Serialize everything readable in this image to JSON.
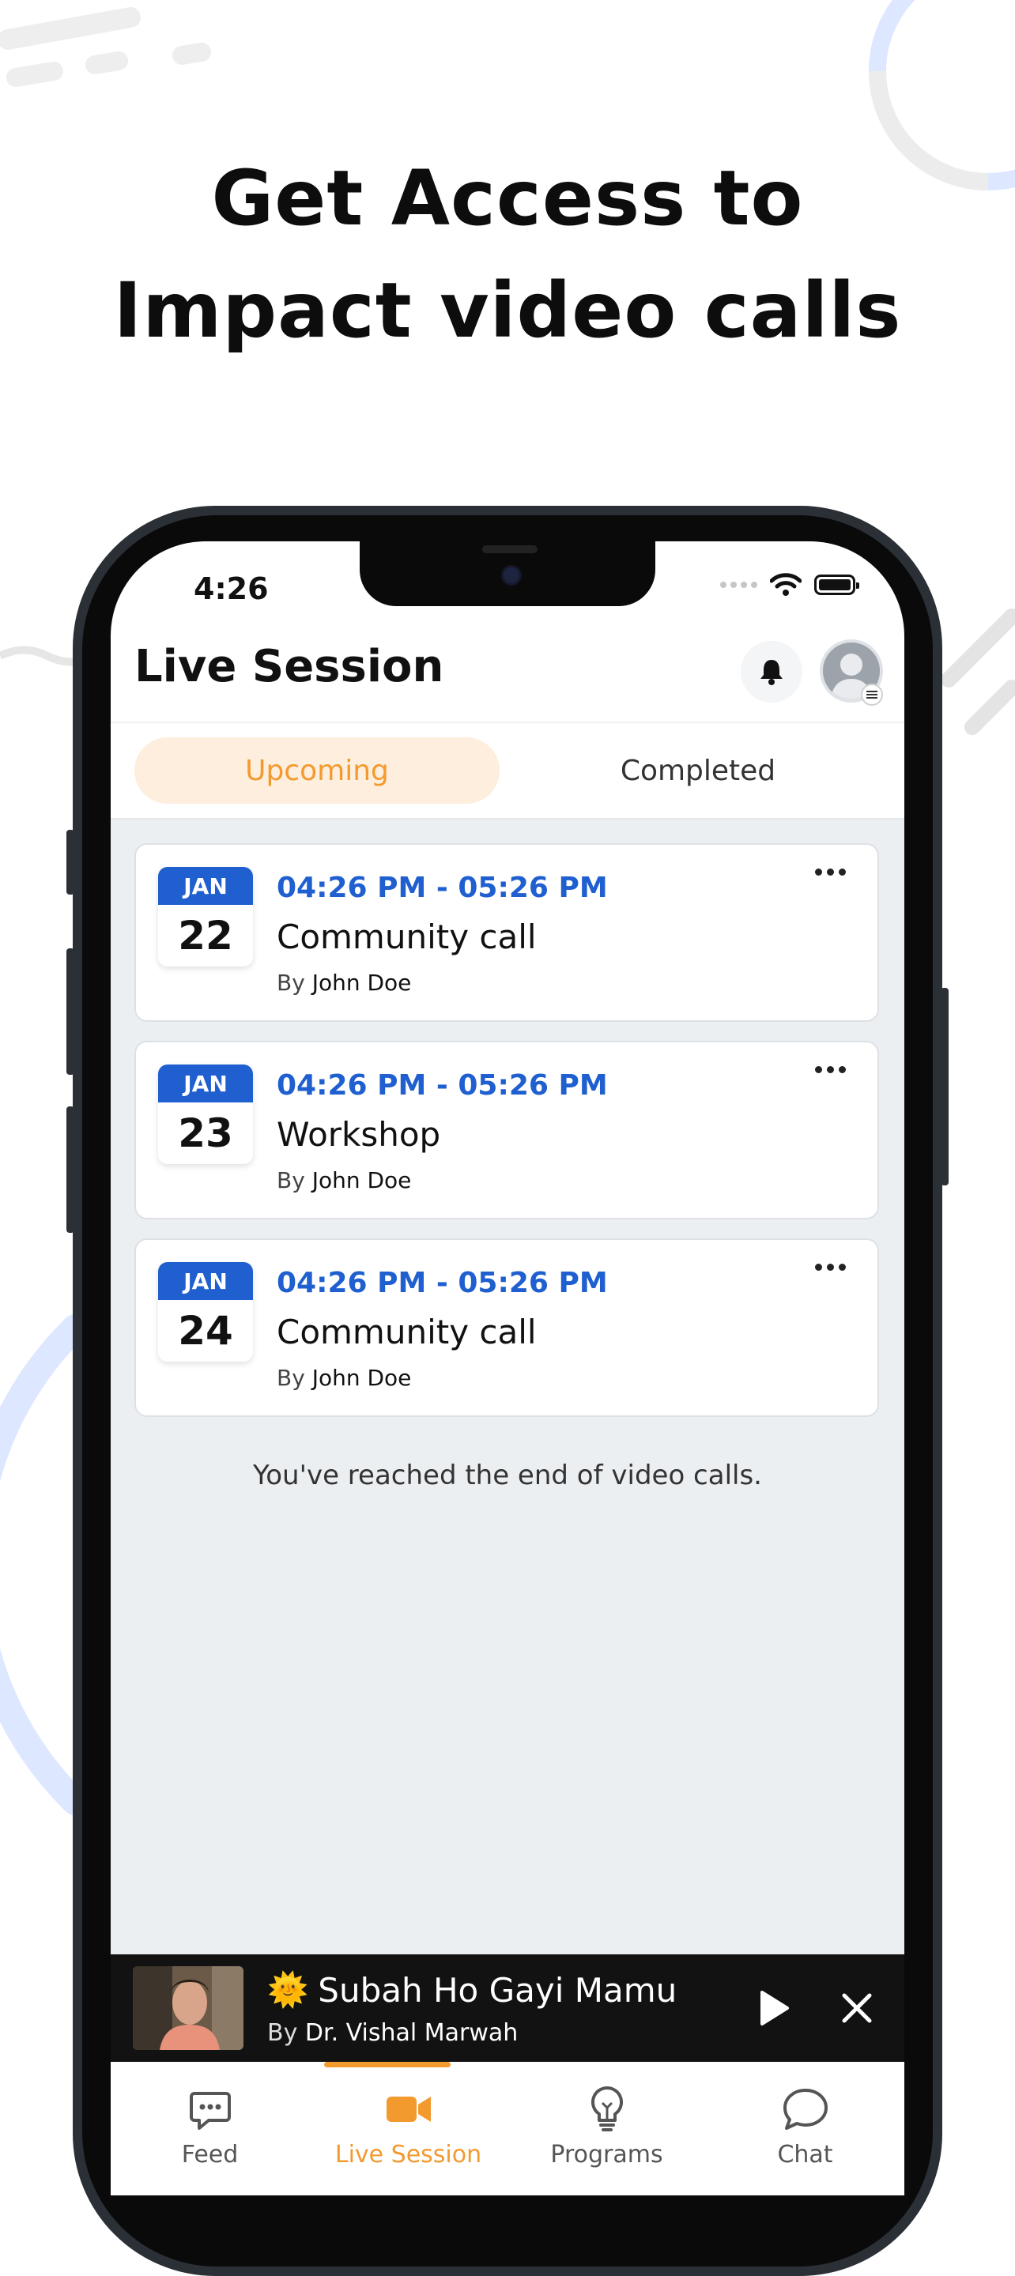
{
  "headline": {
    "line1": "Get Access to",
    "line2": "Impact video calls"
  },
  "status_bar": {
    "time": "4:26"
  },
  "header": {
    "title": "Live Session"
  },
  "tabs": [
    {
      "label": "Upcoming",
      "active": true
    },
    {
      "label": "Completed",
      "active": false
    }
  ],
  "sessions": [
    {
      "month": "JAN",
      "day": "22",
      "time": "04:26 PM - 05:26 PM",
      "title": "Community call",
      "by_prefix": "By",
      "host": "John Doe"
    },
    {
      "month": "JAN",
      "day": "23",
      "time": "04:26 PM - 05:26 PM",
      "title": "Workshop",
      "by_prefix": "By",
      "host": "John Doe"
    },
    {
      "month": "JAN",
      "day": "24",
      "time": "04:26 PM - 05:26 PM",
      "title": "Community call",
      "by_prefix": "By",
      "host": "John Doe"
    }
  ],
  "end_note": "You've reached the end of video calls.",
  "player": {
    "emoji": "🌞",
    "title": "Subah Ho Gayi Mamu",
    "by_prefix": "By",
    "author": "Dr. Vishal Marwah"
  },
  "bottom_nav": [
    {
      "label": "Feed",
      "icon": "feed-chat-icon",
      "active": false
    },
    {
      "label": "Live Session",
      "icon": "video-camera-icon",
      "active": true
    },
    {
      "label": "Programs",
      "icon": "lightbulb-icon",
      "active": false
    },
    {
      "label": "Chat",
      "icon": "chat-bubble-icon",
      "active": false
    }
  ],
  "colors": {
    "accent_orange": "#f39a2f",
    "accent_blue": "#1f5fcf",
    "tab_active_bg": "#fdeedd",
    "content_bg": "#eceff2"
  }
}
